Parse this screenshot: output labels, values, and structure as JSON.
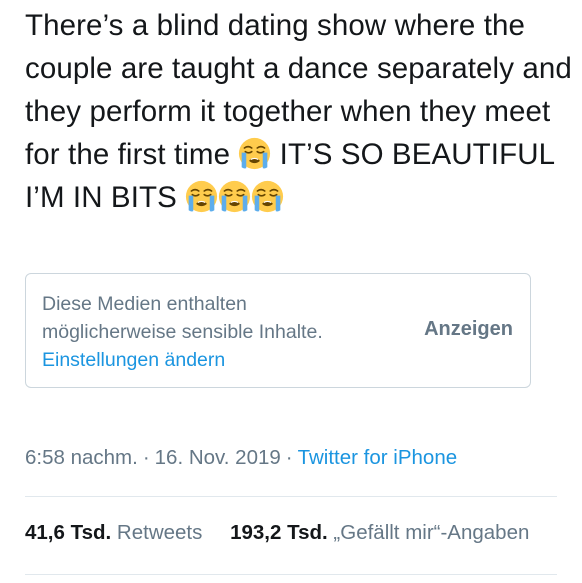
{
  "tweet": {
    "text_part1": "There’s a blind dating show where the couple are taught a dance separately and they perform it together when they meet for the first time ",
    "text_part2": " IT’S SO BEAUTIFUL I’M IN BITS ",
    "emoji_name": "loudly-crying-face"
  },
  "media_warning": {
    "message": "Diese Medien enthalten möglicherweise sensible Inhalte.",
    "settings_link": "Einstellungen ändern",
    "show_button": "Anzeigen"
  },
  "meta": {
    "time": "6:58 nachm.",
    "separator": "·",
    "date": "16. Nov. 2019",
    "source": "Twitter for iPhone"
  },
  "stats": {
    "retweets_count": "41,6 Tsd.",
    "retweets_label": "Retweets",
    "likes_count": "193,2 Tsd.",
    "likes_label": "„Gefällt mir“-Angaben"
  },
  "colors": {
    "text": "#14171a",
    "secondary": "#657786",
    "link": "#1b95e0",
    "border": "#ccd6dd"
  }
}
